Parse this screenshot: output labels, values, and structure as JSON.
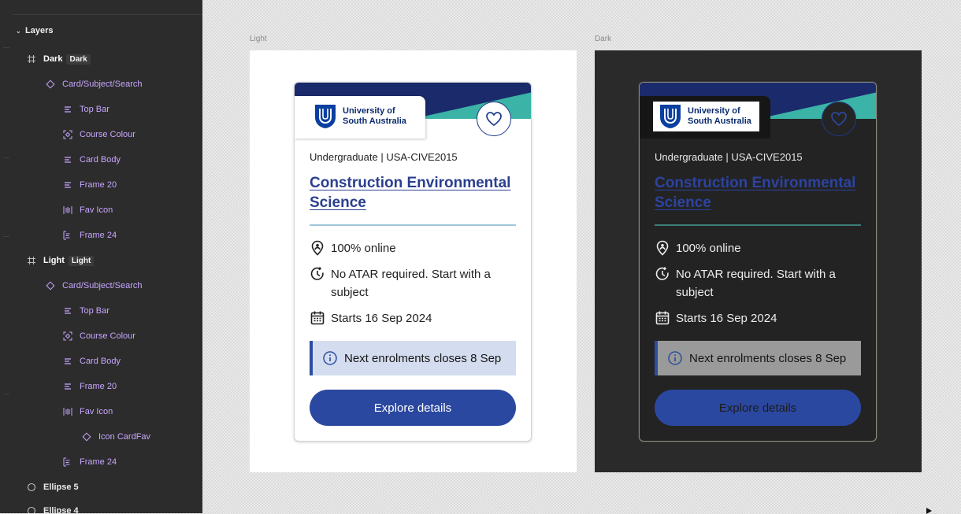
{
  "layers_panel": {
    "header": "Layers",
    "rows": [
      {
        "label": "Dark",
        "badge": "Dark",
        "kind": "frame"
      },
      {
        "label": "Card/Subject/Search",
        "kind": "instance"
      },
      {
        "label": "Top Bar",
        "kind": "auto-layout"
      },
      {
        "label": "Course Colour",
        "kind": "component-frame"
      },
      {
        "label": "Card Body",
        "kind": "auto-layout"
      },
      {
        "label": "Frame 20",
        "kind": "auto-layout"
      },
      {
        "label": "Fav Icon",
        "kind": "auto-layout-vertical"
      },
      {
        "label": "Frame 24",
        "kind": "auto-layout-wrap"
      },
      {
        "label": "Light",
        "badge": "Light",
        "kind": "frame"
      },
      {
        "label": "Card/Subject/Search",
        "kind": "instance"
      },
      {
        "label": "Top Bar",
        "kind": "auto-layout"
      },
      {
        "label": "Course Colour",
        "kind": "component-frame"
      },
      {
        "label": "Card Body",
        "kind": "auto-layout"
      },
      {
        "label": "Frame 20",
        "kind": "auto-layout"
      },
      {
        "label": "Fav Icon",
        "kind": "auto-layout-vertical"
      },
      {
        "label": "Icon CardFav",
        "kind": "instance"
      },
      {
        "label": "Frame 24",
        "kind": "auto-layout-wrap"
      },
      {
        "label": "Ellipse 5",
        "kind": "ellipse"
      },
      {
        "label": "Ellipse 4",
        "kind": "ellipse"
      }
    ]
  },
  "canvas": {
    "light_label": "Light",
    "dark_label": "Dark"
  },
  "card": {
    "logo_line1": "University of",
    "logo_line2": "South Australia",
    "meta": "Undergraduate | USA-CIVE2015",
    "title": "Construction Environmental Science",
    "mode": "100% online",
    "entry": "No ATAR required. Start with a subject",
    "start": "Starts 16 Sep 2024",
    "notice": "Next enrolments closes 8 Sep",
    "cta": "Explore details"
  },
  "colors": {
    "navy": "#1b2a6b",
    "teal": "#3bb3a6",
    "link_blue": "#2a3f8f",
    "cta_blue": "#2b48a0",
    "component_purple": "#c7a6ff"
  }
}
